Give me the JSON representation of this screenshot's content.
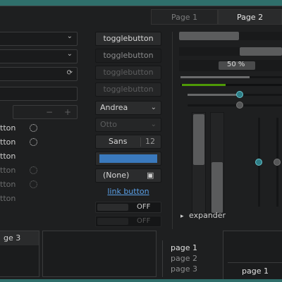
{
  "tabs": {
    "page1": "Page 1",
    "page2": "Page 2"
  },
  "left": {
    "spin_rows": [
      "tton",
      "tton",
      "tton",
      "tton",
      "tton",
      "tton"
    ],
    "minus": "−",
    "plus": "+"
  },
  "middle": {
    "toggle1": "togglebutton",
    "toggle2": "togglebutton",
    "toggle3": "togglebutton",
    "toggle4": "togglebutton",
    "combo1": "Andrea",
    "combo2": "Otto",
    "font_name": "Sans",
    "font_size": "12",
    "color_value": "#3a79bd",
    "file_none": "(None)",
    "link": "link button",
    "switch1_state": "OFF",
    "switch2_state": "OFF"
  },
  "right": {
    "progress_label": "50 %",
    "expander": "expander",
    "h_progress1": 0.55,
    "h_progress2": 0.7
  },
  "bottom": {
    "left_tab": "ge 3",
    "pages": [
      "page 1",
      "page 2",
      "page 3"
    ],
    "right_tab": "page 1"
  },
  "icons": {
    "chevron": "⌄",
    "refresh": "⟳",
    "file": "▣",
    "expander_arrow": "▸"
  },
  "colors": {
    "accent": "#3a79bd",
    "teal": "#2f6f6b",
    "link": "#5aa0e8",
    "green": "#4e9a06"
  }
}
